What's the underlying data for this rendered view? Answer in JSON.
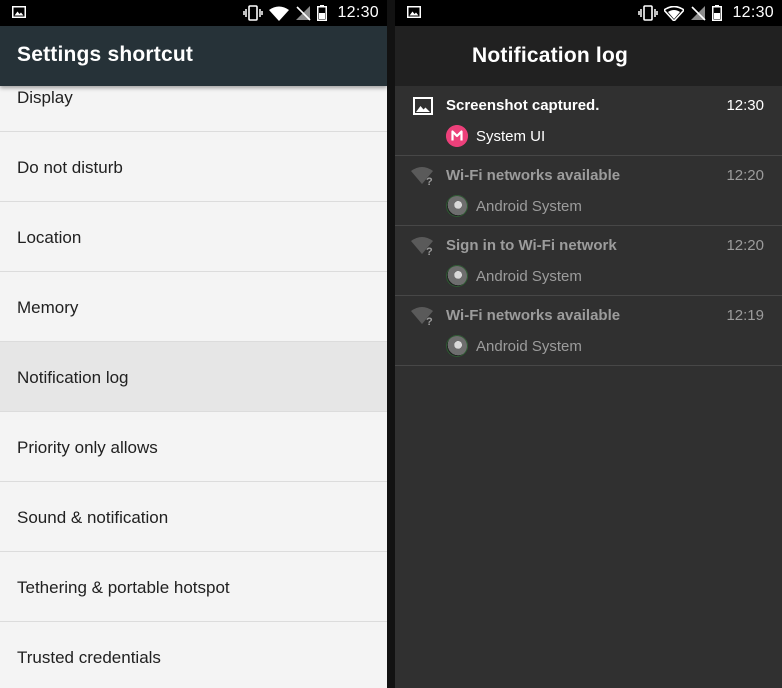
{
  "status_bar": {
    "time": "12:30",
    "icons": [
      "image-icon",
      "vibrate-icon",
      "wifi-icon",
      "no-sim-icon",
      "battery-icon"
    ]
  },
  "left_screen": {
    "title": "Settings shortcut",
    "items": [
      {
        "label": "Display"
      },
      {
        "label": "Do not disturb"
      },
      {
        "label": "Location"
      },
      {
        "label": "Memory"
      },
      {
        "label": "Notification log",
        "selected": true
      },
      {
        "label": "Priority only allows"
      },
      {
        "label": "Sound & notification"
      },
      {
        "label": "Tethering & portable hotspot"
      },
      {
        "label": "Trusted credentials"
      }
    ]
  },
  "right_screen": {
    "title": "Notification log",
    "notifications": [
      {
        "title": "Screenshot captured.",
        "time": "12:30",
        "app": "System UI",
        "icon": "image-icon",
        "app_icon": "system-ui-icon",
        "active": true
      },
      {
        "title": "Wi-Fi networks available",
        "time": "12:20",
        "app": "Android System",
        "icon": "wifi-question-icon",
        "app_icon": "android-system-icon",
        "active": false
      },
      {
        "title": "Sign in to Wi-Fi network",
        "time": "12:20",
        "app": "Android System",
        "icon": "wifi-question-icon",
        "app_icon": "android-system-icon",
        "active": false
      },
      {
        "title": "Wi-Fi networks available",
        "time": "12:19",
        "app": "Android System",
        "icon": "wifi-question-icon",
        "app_icon": "android-system-icon",
        "active": false
      }
    ]
  },
  "colors": {
    "left_appbar": "#263238",
    "left_background": "#f4f4f4",
    "selected_item": "#e6e6e6",
    "right_background": "#303030",
    "right_appbar": "#212121",
    "system_ui_accent": "#ec407a"
  }
}
